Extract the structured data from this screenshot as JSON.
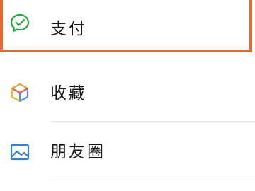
{
  "menu": {
    "items": [
      {
        "label": "支付",
        "icon": "wechat-pay-icon",
        "highlighted": true
      },
      {
        "label": "收藏",
        "icon": "favorites-cube-icon",
        "highlighted": false
      },
      {
        "label": "朋友圈",
        "icon": "moments-image-icon",
        "highlighted": false
      }
    ]
  },
  "colors": {
    "highlight_border": "#e46a3c",
    "pay_icon": "#2ba245",
    "moments_icon": "#3b7fc4",
    "divider": "#e6e6e6"
  }
}
